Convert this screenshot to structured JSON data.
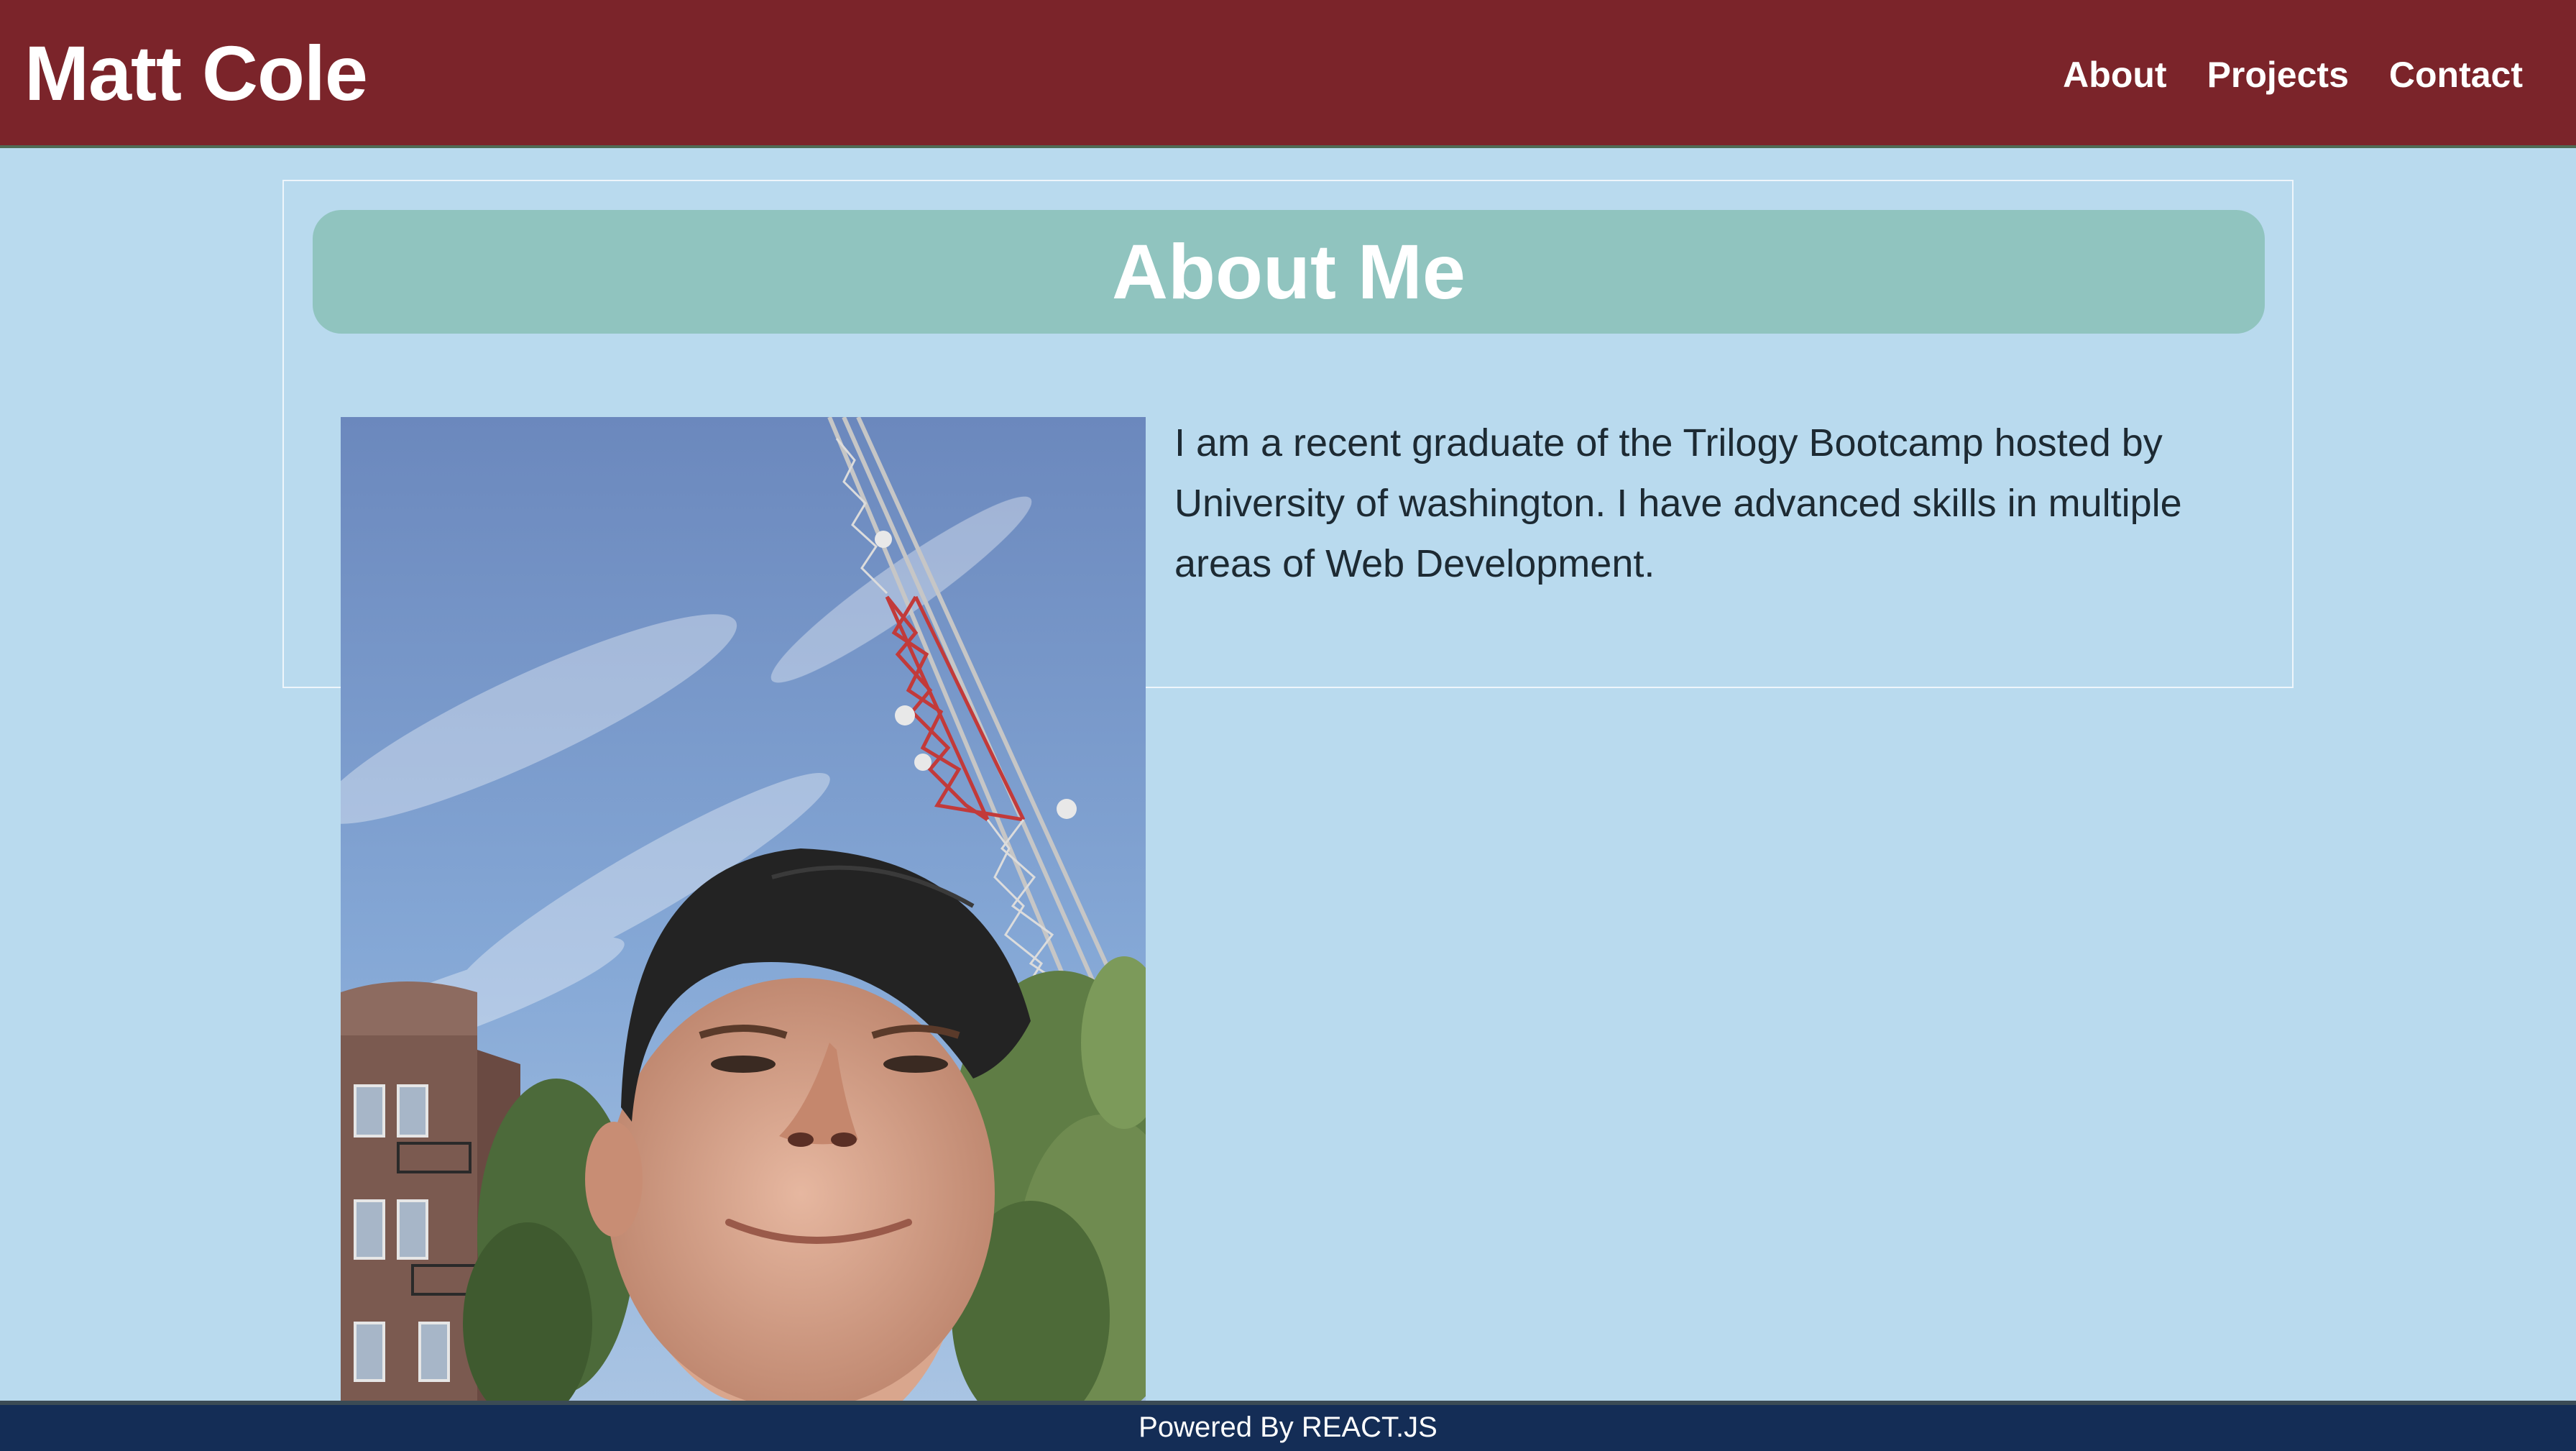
{
  "header": {
    "brand": "Matt Cole",
    "nav": [
      {
        "label": "About"
      },
      {
        "label": "Projects"
      },
      {
        "label": "Contact"
      }
    ]
  },
  "about": {
    "title": "About Me",
    "bio": "I am a recent graduate of the Trilogy Bootcamp hosted by University of washington. I have advanced skills in multiple areas of Web Development.",
    "photo_icon": "profile-photo"
  },
  "footer": {
    "text": "Powered By REACT.JS"
  },
  "colors": {
    "page_background": "#b9daee",
    "header_background": "#7b242a",
    "title_bar": "#90c4bf",
    "footer_background": "#142d56",
    "text_primary": "#1d2a33",
    "text_light": "#ffffff"
  }
}
